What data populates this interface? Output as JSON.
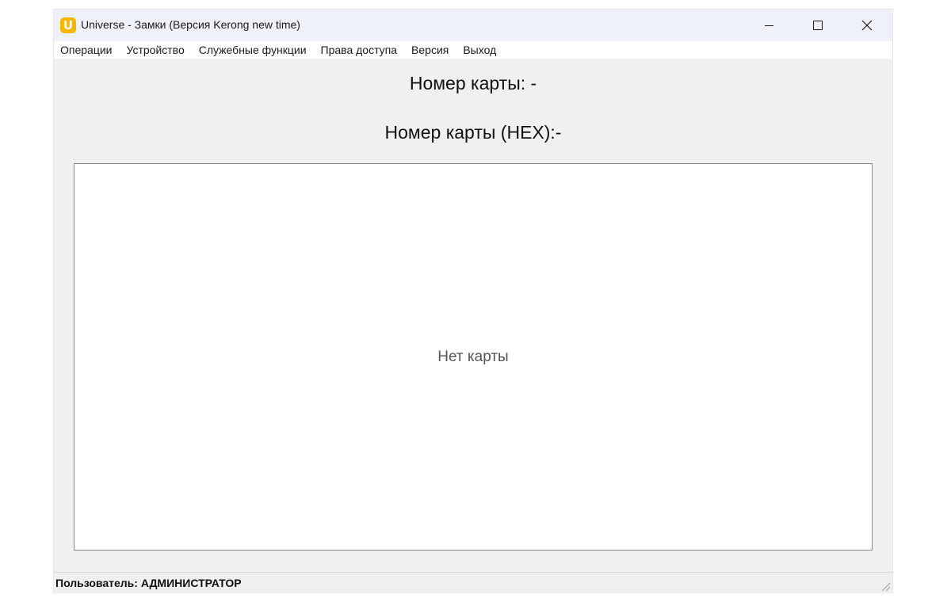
{
  "window": {
    "title": "Universe - Замки (Версия Kerong new time)",
    "app_icon_letter": "U",
    "icon_color": "#f5b800"
  },
  "title_controls": {
    "minimize_icon": "minimize-icon",
    "maximize_icon": "maximize-icon",
    "close_icon": "close-icon",
    "close_glyph": "✕"
  },
  "menu": {
    "items": [
      {
        "label": "Операции"
      },
      {
        "label": "Устройство"
      },
      {
        "label": "Служебные функции"
      },
      {
        "label": "Права доступа"
      },
      {
        "label": "Версия"
      },
      {
        "label": "Выход"
      }
    ]
  },
  "main": {
    "card_number": "Номер карты: -",
    "card_number_hex": "Номер карты (HEX):-",
    "card_panel": {
      "placeholder": "Нет карты"
    }
  },
  "status": {
    "user": "Пользователь: АДМИНИСТРАТОР"
  }
}
